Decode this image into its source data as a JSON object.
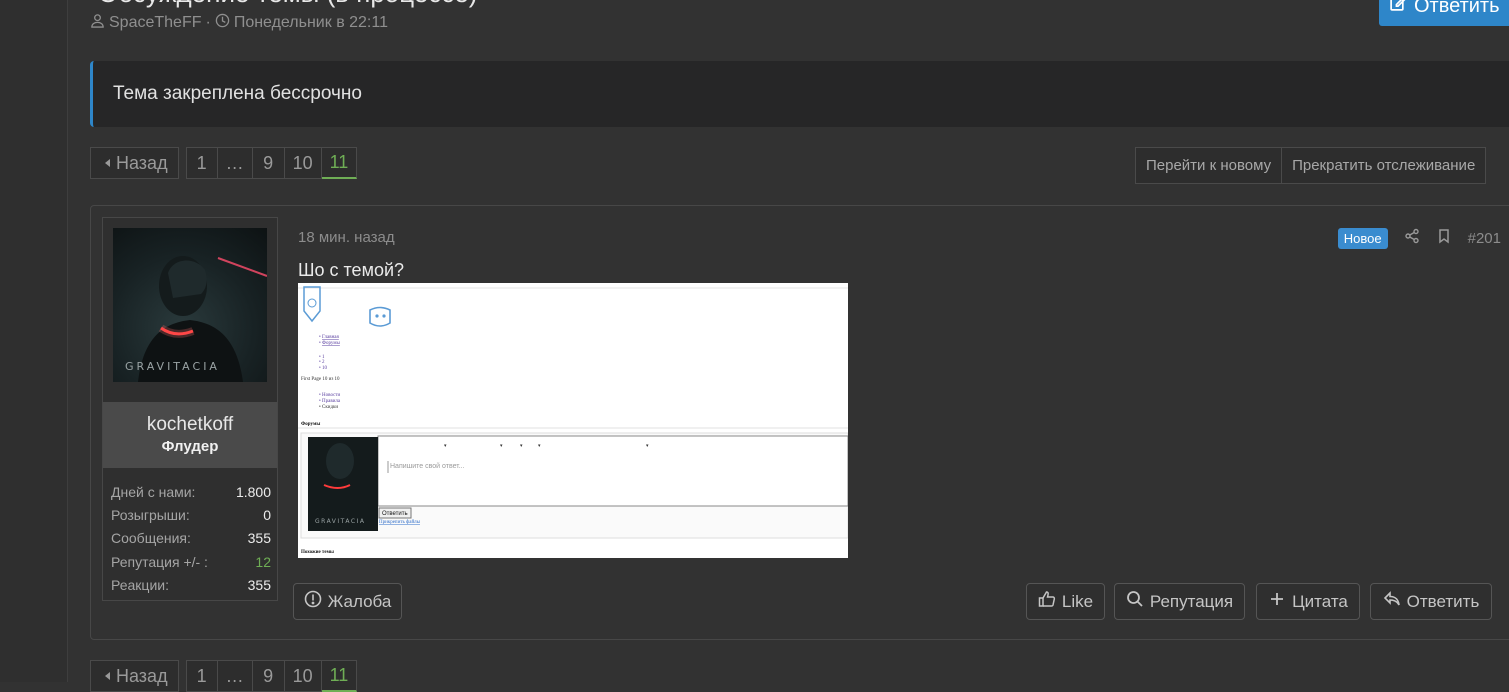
{
  "thread": {
    "title": "Обсуждение темы (в процессе)",
    "author": "SpaceTheFF",
    "separator": "·",
    "date": "Понедельник в 22:11",
    "reply_label": "Ответить"
  },
  "notice": {
    "text": "Тема закреплена бессрочно"
  },
  "pagination": {
    "back_label": "Назад",
    "pages": [
      "1",
      "…",
      "9",
      "10",
      "11"
    ],
    "current": "11"
  },
  "watch": {
    "goto_new": "Перейти к новому",
    "unwatch": "Прекратить отслеживание"
  },
  "post": {
    "time": "18 мин. назад",
    "badge": "Новое",
    "number": "#201",
    "text": "Шо с темой?",
    "user": {
      "name": "kochetkoff",
      "role": "Флудер",
      "avatar_text": "GRAVITACIA",
      "stats": [
        {
          "label": "Дней с нами:",
          "value": "1.800"
        },
        {
          "label": "Розыгрыши:",
          "value": "0"
        },
        {
          "label": "Сообщения:",
          "value": "355"
        },
        {
          "label": "Репутация +/- :",
          "value": "12",
          "color": "#6fae55"
        },
        {
          "label": "Реакции:",
          "value": "355"
        }
      ]
    },
    "attachment": {
      "links": [
        "Главная",
        "Форумы"
      ],
      "pages": [
        "1",
        "2",
        "10"
      ],
      "first_page": "First Page 10 из 10",
      "menu": [
        "Новости",
        "Правила",
        "Скидки"
      ],
      "forum_label": "Форумы",
      "reply_placeholder": "Напишите свой ответ...",
      "reply_button": "Ответить",
      "attach_files": "Прикрепить файлы",
      "similar_threads": "Похожие темы",
      "avatar_text": "GRAVITACIA"
    },
    "actions": {
      "report": "Жалоба",
      "like": "Like",
      "reputation": "Репутация",
      "quote": "Цитата",
      "reply": "Ответить"
    }
  },
  "colors": {
    "accent": "#2e86c9",
    "green": "#6fae55",
    "background": "#323232"
  }
}
